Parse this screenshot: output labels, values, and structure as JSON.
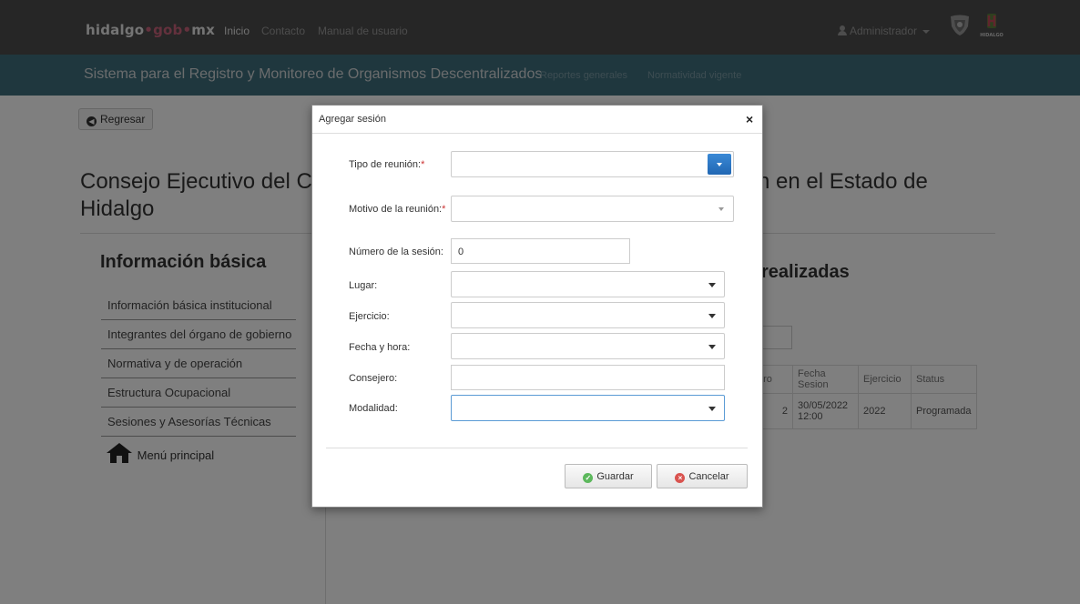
{
  "topnav": {
    "brand": {
      "part1": "hidalgo",
      "dot1": "•",
      "part2": "gob",
      "dot2": "•",
      "part3": "mx"
    },
    "links": [
      "Inicio",
      "Contacto",
      "Manual de usuario"
    ],
    "user_label": "Administrador",
    "logo_text": "HIDALGO"
  },
  "subnav": {
    "system_title": "Sistema para el Registro y Monitoreo de Organismos Descentralizados",
    "links": [
      "Reportes generales",
      "Normatividad vigente"
    ]
  },
  "page": {
    "back_label": "Regresar",
    "title_left": "Consejo Ejecutivo del C",
    "title_left_line2": "Hidalgo",
    "title_right": "n en el Estado de",
    "section_heading": "Información básica",
    "side_menu": [
      "Información básica institucional",
      "Integrantes del órgano de gobierno",
      "Normativa y de operación",
      "Estructura Ocupacional",
      "Sesiones y Asesorías Técnicas"
    ],
    "menu_principal": "Menú principal",
    "realizadas_heading": "realizadas",
    "table": {
      "headers": [
        "ero",
        "Fecha Sesion",
        "Ejercicio",
        "Status"
      ],
      "rows": [
        {
          "numero": "2",
          "fecha": "30/05/2022 12:00",
          "ejercicio": "2022",
          "status": "Programada"
        }
      ]
    }
  },
  "modal": {
    "title": "Agregar sesión",
    "close_symbol": "×",
    "fields": {
      "tipo_reunion": {
        "label": "Tipo de reunión:",
        "required": "*",
        "value": ""
      },
      "motivo_reunion": {
        "label": "Motivo de la reunión:",
        "required": "*",
        "value": ""
      },
      "numero_sesion": {
        "label": "Número de la sesión:",
        "value": "0"
      },
      "lugar": {
        "label": "Lugar:",
        "value": ""
      },
      "ejercicio": {
        "label": "Ejercicio:",
        "value": ""
      },
      "fecha_hora": {
        "label": "Fecha y hora:",
        "value": ""
      },
      "consejero": {
        "label": "Consejero:",
        "value": ""
      },
      "modalidad": {
        "label": "Modalidad:",
        "value": ""
      }
    },
    "buttons": {
      "save": "Guardar",
      "cancel": "Cancelar"
    }
  },
  "colors": {
    "topnav": "#4d4d4d",
    "subnav": "#3f6e7c",
    "primary_blue": "#2a78c8",
    "success_green": "#5cb85c",
    "danger_red": "#d9534f"
  }
}
